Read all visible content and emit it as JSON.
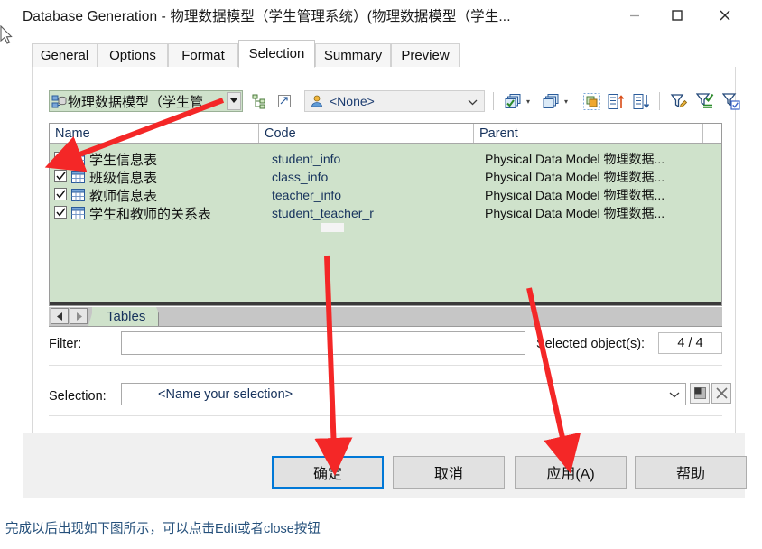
{
  "window": {
    "title": "Database Generation - 物理数据模型（学生管理系统）(物理数据模型（学生...",
    "minimize_label": "—",
    "maximize_label": "□",
    "close_label": "✕"
  },
  "tabs": [
    {
      "label": "General",
      "active": false
    },
    {
      "label": "Options",
      "active": false
    },
    {
      "label": "Format",
      "active": false
    },
    {
      "label": "Selection",
      "active": true
    },
    {
      "label": "Summary",
      "active": false
    },
    {
      "label": "Preview",
      "active": false
    }
  ],
  "toolbar": {
    "model_combo_value": "物理数据模型（学生管",
    "model_combo_icon": "model-icon",
    "model_combo_arrow": "▼",
    "tree_icon": "tree-view-icon",
    "expand_icon": "expand-icon",
    "owner_icon": "user-icon",
    "owner_value": "<None>",
    "owner_arrow": "⌄",
    "select_all_icon": "select-all-icon",
    "deselect_all_icon": "deselect-all-icon",
    "dropdown_caret": "▾",
    "invert_icon": "invert-selection-icon",
    "sort_asc_icon": "sort-ascending-icon",
    "sort_desc_icon": "sort-descending-icon",
    "filter_edit_icon": "filter-edit-icon",
    "filter_apply_icon": "filter-apply-icon",
    "filter_check_icon": "filter-check-icon"
  },
  "list": {
    "columns": [
      "Name",
      "Code",
      "Parent"
    ],
    "rows": [
      {
        "checked": true,
        "icon": "table-icon",
        "name": "学生信息表",
        "code": "student_info",
        "parent": "Physical Data Model 物理数据..."
      },
      {
        "checked": true,
        "icon": "table-icon",
        "name": "班级信息表",
        "code": "class_info",
        "parent": "Physical Data Model 物理数据..."
      },
      {
        "checked": true,
        "icon": "table-icon",
        "name": "教师信息表",
        "code": "teacher_info",
        "parent": "Physical Data Model 物理数据..."
      },
      {
        "checked": true,
        "icon": "table-icon",
        "name": "学生和教师的关系表",
        "code": "student_teacher_r",
        "parent": "Physical Data Model 物理数据..."
      }
    ]
  },
  "page_tabs": {
    "prev_label": "◄",
    "next_label": "►",
    "active_tab": "Tables"
  },
  "filter": {
    "label": "Filter:",
    "value": "",
    "placeholder": ""
  },
  "selected_objects": {
    "label": "Selected object(s):",
    "value": "4 / 4"
  },
  "selection": {
    "label": "Selection:",
    "value": "<Name your selection>",
    "dropdown_arrow": "⌄",
    "save_icon": "save-selection-icon",
    "delete_icon": "delete-selection-icon"
  },
  "footer": {
    "ok_label": "确定",
    "cancel_label": "取消",
    "apply_label": "应用(A)",
    "help_label": "帮助"
  },
  "caption": "完成以后出现如下图所示，可以点击Edit或者close按钮",
  "colors": {
    "list_green": "#cfe2cb",
    "accent_blue": "#0078d7",
    "annotation_red": "#f42727",
    "text_blue": "#16325c"
  }
}
